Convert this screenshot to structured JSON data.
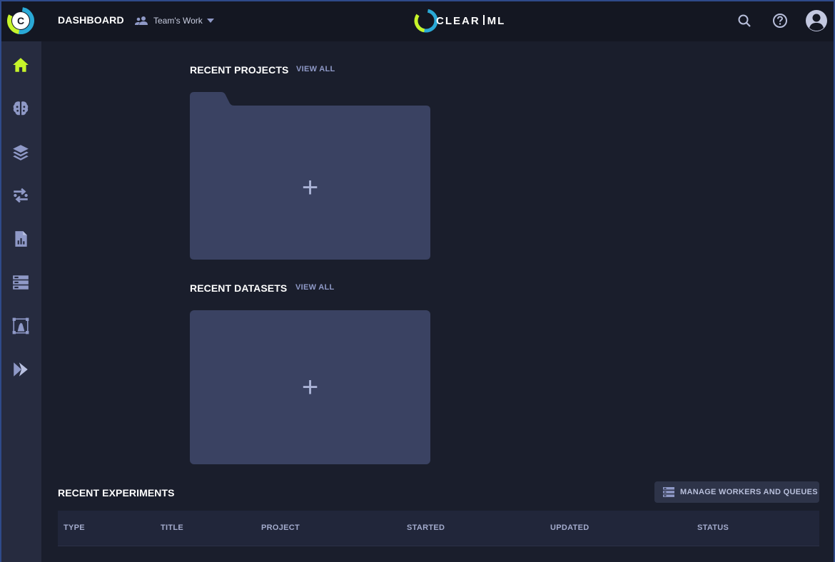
{
  "header": {
    "page_title": "DASHBOARD",
    "workspace_label": "Team's Work",
    "brand_left": "CLEAR",
    "brand_right": "ML"
  },
  "sidebar": {
    "items": [
      {
        "name": "home",
        "icon": "home-icon",
        "active": true
      },
      {
        "name": "projects",
        "icon": "brain-icon"
      },
      {
        "name": "datasets",
        "icon": "layers-icon"
      },
      {
        "name": "pipelines",
        "icon": "pipeline-icon"
      },
      {
        "name": "reports",
        "icon": "report-icon"
      },
      {
        "name": "workers",
        "icon": "server-icon"
      },
      {
        "name": "annotations",
        "icon": "annotation-icon"
      },
      {
        "name": "deploy",
        "icon": "deploy-icon"
      }
    ]
  },
  "recent_projects": {
    "title": "RECENT PROJECTS",
    "view_all": "VIEW ALL",
    "new_label": "+"
  },
  "recent_datasets": {
    "title": "RECENT DATASETS",
    "view_all": "VIEW ALL",
    "new_label": "+"
  },
  "recent_experiments": {
    "title": "RECENT EXPERIMENTS",
    "manage_button": "MANAGE WORKERS AND QUEUES",
    "columns": [
      "TYPE",
      "TITLE",
      "PROJECT",
      "STARTED",
      "UPDATED",
      "STATUS"
    ]
  },
  "colors": {
    "accent": "#c6f42a",
    "background": "#1a1e2c",
    "card": "#3a4262",
    "header": "#141722",
    "sidebar": "#262b3f"
  }
}
